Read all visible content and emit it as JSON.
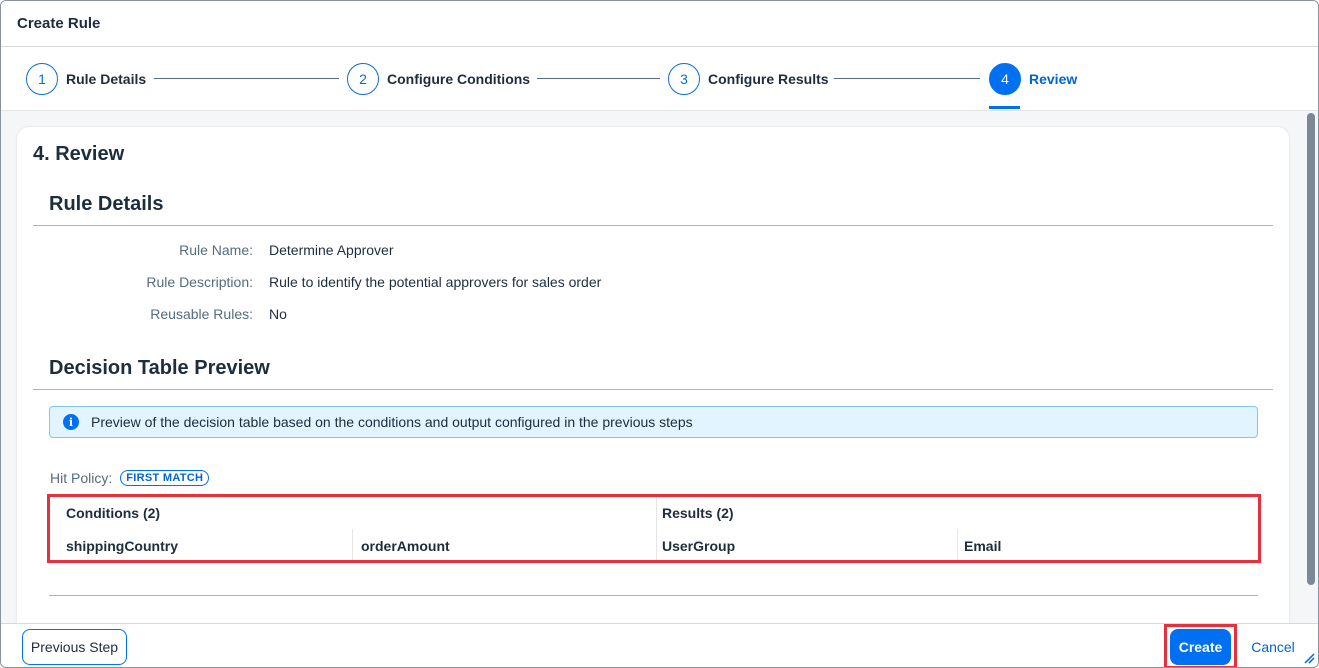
{
  "header": {
    "title": "Create Rule"
  },
  "wizard": {
    "steps": [
      {
        "number": "1",
        "label": "Rule Details"
      },
      {
        "number": "2",
        "label": "Configure Conditions"
      },
      {
        "number": "3",
        "label": "Configure Results"
      },
      {
        "number": "4",
        "label": "Review"
      }
    ],
    "active_step": 4
  },
  "review": {
    "title": "4. Review",
    "rule_details": {
      "title": "Rule Details",
      "fields": [
        {
          "label": "Rule Name:",
          "value": "Determine Approver"
        },
        {
          "label": "Rule Description:",
          "value": "Rule to identify the potential approvers for sales order"
        },
        {
          "label": "Reusable Rules:",
          "value": "No"
        }
      ]
    },
    "decision_table": {
      "title": "Decision Table Preview",
      "info_text": "Preview of the decision table based on the conditions and output configured in the previous steps",
      "hit_policy_label": "Hit Policy:",
      "hit_policy_value": "FIRST MATCH",
      "conditions_header": "Conditions (2)",
      "results_header": "Results (2)",
      "columns": [
        "shippingCountry",
        "orderAmount",
        "UserGroup",
        "Email"
      ]
    }
  },
  "footer": {
    "previous_label": "Previous Step",
    "create_label": "Create",
    "cancel_label": "Cancel"
  },
  "colors": {
    "accent": "#0070f2",
    "highlight": "#e6303b",
    "info_bg": "#e1f4ff"
  }
}
